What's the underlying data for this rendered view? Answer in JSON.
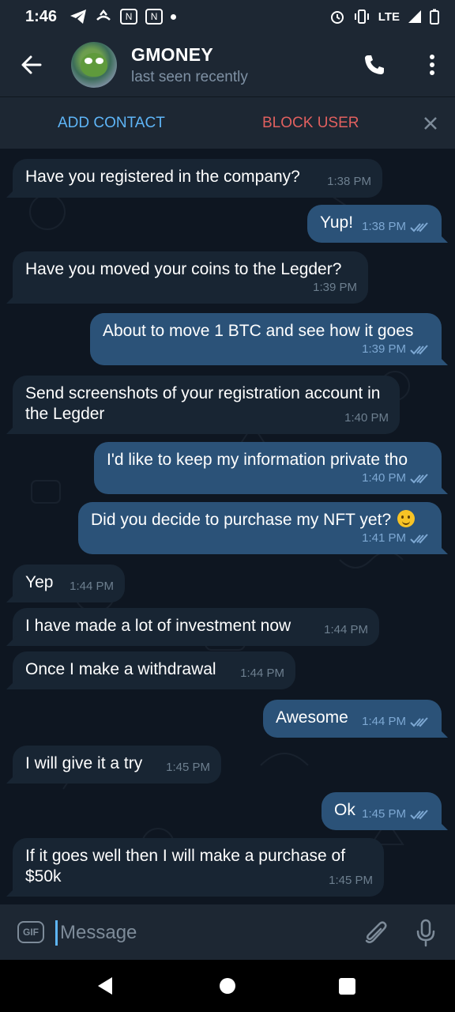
{
  "status_bar": {
    "time": "1:46",
    "network": "LTE",
    "icons": [
      "telegram-icon",
      "call-forward-icon",
      "n-icon",
      "n-icon",
      "dot-icon",
      "alarm-icon",
      "vibrate-icon",
      "signal-icon",
      "battery-icon"
    ]
  },
  "header": {
    "name": "GMONEY",
    "status": "last seen recently",
    "icons": {
      "back": "arrow-left-icon",
      "call": "phone-icon",
      "menu": "more-vertical-icon"
    }
  },
  "action_bar": {
    "add_contact": "ADD CONTACT",
    "block_user": "BLOCK USER",
    "colors": {
      "add": "#5eb5f7",
      "block": "#e1605f"
    }
  },
  "messages": [
    {
      "dir": "in",
      "text": "Have you registered in the company?",
      "time": "1:38 PM"
    },
    {
      "dir": "out",
      "text": "Yup!",
      "time": "1:38 PM",
      "read": true
    },
    {
      "dir": "in",
      "text": "Have you moved your coins to the Legder?",
      "time": "1:39 PM"
    },
    {
      "dir": "out",
      "text": "About to move 1 BTC and see how it goes",
      "time": "1:39 PM",
      "read": true
    },
    {
      "dir": "in",
      "text": "Send screenshots of your registration account in the Legder",
      "time": "1:40 PM"
    },
    {
      "dir": "out",
      "text": "I'd like to keep my information private tho",
      "time": "1:40 PM",
      "read": true
    },
    {
      "dir": "out",
      "text": "Did you decide to purchase my NFT yet?",
      "emoji": "slightly-smiling-face",
      "time": "1:41 PM",
      "read": true
    },
    {
      "dir": "in",
      "text": "Yep",
      "time": "1:44 PM"
    },
    {
      "dir": "in",
      "text": "I have made a lot of investment now",
      "time": "1:44 PM"
    },
    {
      "dir": "in",
      "text": "Once I make a withdrawal",
      "time": "1:44 PM"
    },
    {
      "dir": "out",
      "text": "Awesome",
      "time": "1:44 PM",
      "read": true
    },
    {
      "dir": "in",
      "text": "I will give it a try",
      "time": "1:45 PM"
    },
    {
      "dir": "out",
      "text": "Ok",
      "time": "1:45 PM",
      "read": true
    },
    {
      "dir": "in",
      "text": "If it goes well then I will make a purchase of $50k",
      "time": "1:45 PM"
    }
  ],
  "input": {
    "placeholder": "Message",
    "gif_label": "GIF",
    "icons": {
      "attach": "paperclip-icon",
      "mic": "microphone-icon"
    }
  },
  "nav": {
    "icons": [
      "back-triangle-icon",
      "home-circle-icon",
      "recents-square-icon"
    ]
  },
  "colors": {
    "background": "#0e1621",
    "header": "#1d2733",
    "incoming_bubble": "#182533",
    "outgoing_bubble": "#2b5278",
    "accent": "#5eb5f7"
  }
}
